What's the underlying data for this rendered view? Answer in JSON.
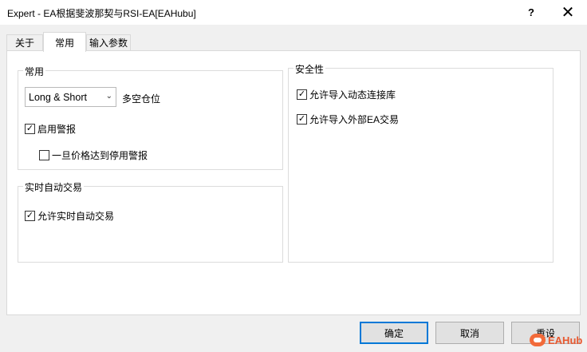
{
  "window": {
    "title": "Expert - EA根据斐波那契与RSI-EA[EAHubu]",
    "help_label": "?",
    "close_label": "✕"
  },
  "tabs": [
    {
      "label": "关于",
      "active": false
    },
    {
      "label": "常用",
      "active": true
    },
    {
      "label": "输入参数",
      "active": false
    }
  ],
  "common_group": {
    "label": "常用",
    "position_select": {
      "value": "Long & Short",
      "label": "多空仓位"
    },
    "enable_alerts": {
      "label": "启用警报",
      "checked": true
    },
    "disable_alerts_on_price": {
      "label": "一旦价格达到停用警报",
      "checked": false
    }
  },
  "live_trading_group": {
    "label": "实时自动交易",
    "allow_live_trading": {
      "label": "允许实时自动交易",
      "checked": true
    }
  },
  "safety_group": {
    "label": "安全性",
    "allow_dll_imports": {
      "label": "允许导入动态连接库",
      "checked": true
    },
    "allow_external_ea": {
      "label": "允许导入外部EA交易",
      "checked": true
    }
  },
  "buttons": {
    "ok": "确定",
    "cancel": "取消",
    "reset": "重设"
  },
  "watermark": {
    "text": "EAHub"
  },
  "checkmark_glyph": "✓"
}
